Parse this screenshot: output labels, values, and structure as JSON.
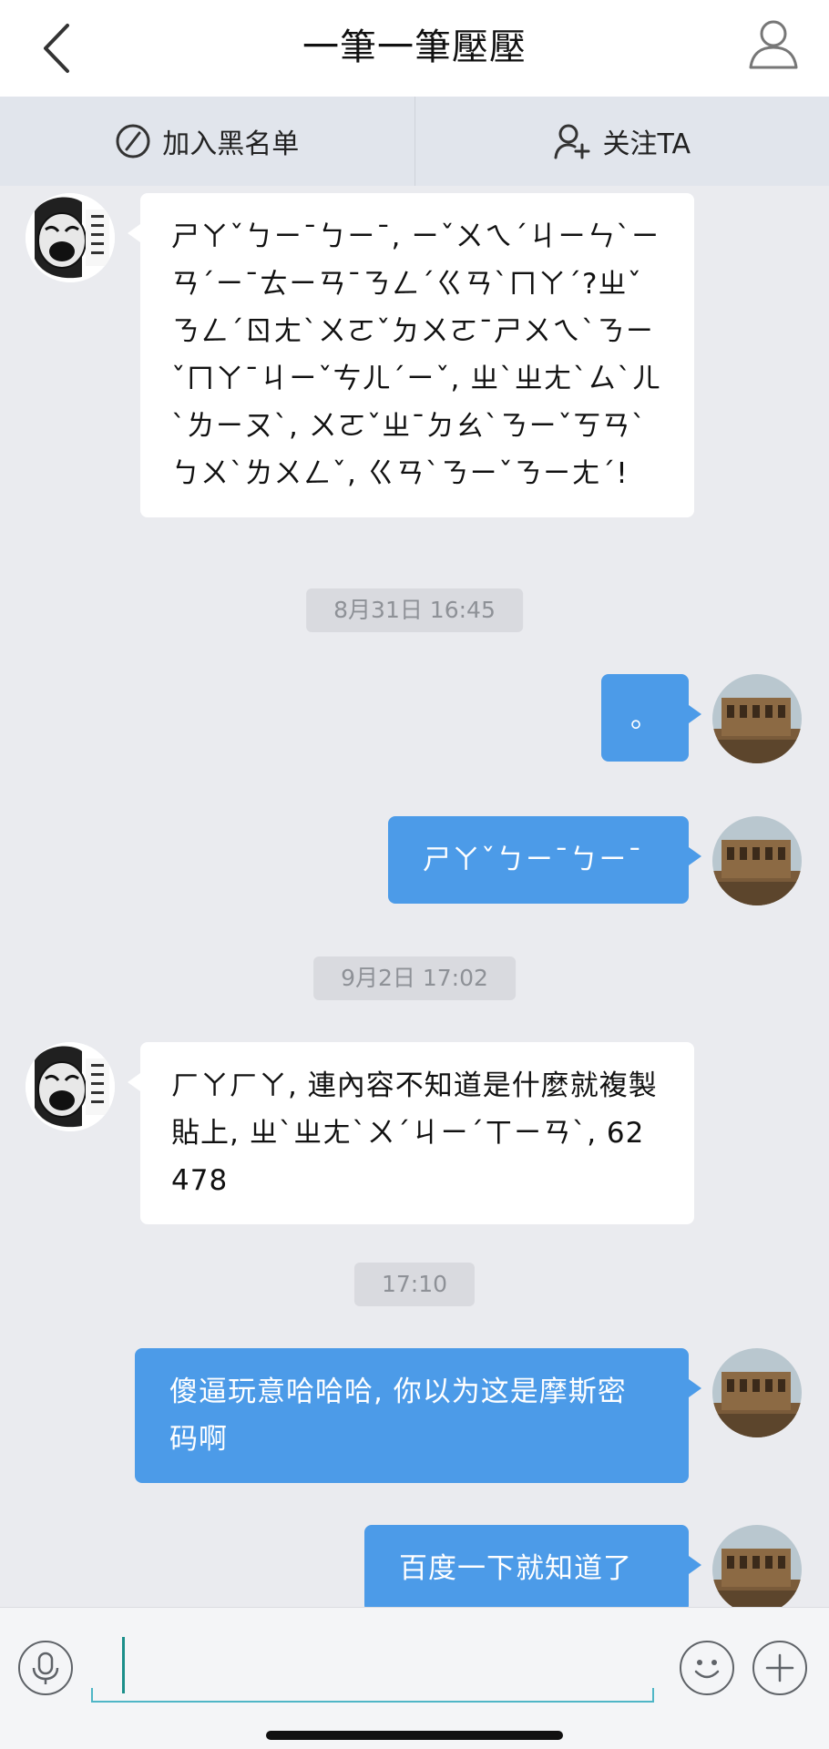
{
  "header": {
    "title": "一筆一筆壓壓"
  },
  "actions": {
    "block_label": "加入黑名单",
    "follow_label": "关注TA"
  },
  "messages": [
    {
      "kind": "in",
      "text": "ㄕㄚˇㄅㄧˉㄅㄧˉ, ㄧˇㄨㄟˊㄐㄧㄣˋㄧㄢˊㄧˉㄊㄧㄢˉㄋㄥˊㄍㄢˋㄇㄚˊ?ㄓˇㄋㄥˊㄖㄤˋㄨㄛˇㄉㄨㄛˉㄕㄨㄟˋㄋㄧˇㄇㄚˉㄐㄧˇㄘㄦˊㄧˇ, ㄓˋㄓㄤˋㄙˋㄦˋㄌㄧㄡˋ, ㄨㄛˇㄓˉㄉㄠˋㄋㄧˇㄎㄢˋㄅㄨˋㄌㄨㄥˇ, ㄍㄢˋㄋㄧˇㄋㄧㄤˊ!"
    },
    {
      "kind": "time",
      "text": "8月31日 16:45"
    },
    {
      "kind": "out",
      "text": "。"
    },
    {
      "kind": "out",
      "text": "ㄕㄚˇㄅㄧˉㄅㄧˉ"
    },
    {
      "kind": "time",
      "text": "9月2日 17:02"
    },
    {
      "kind": "in",
      "text": "ㄏㄚㄏㄚ, 連內容不知道是什麼就複製貼上, ㄓˋㄓㄤˋㄨˊㄐㄧˊㄒㄧㄢˋ, 62478"
    },
    {
      "kind": "time",
      "text": "17:10"
    },
    {
      "kind": "out",
      "text": "傻逼玩意哈哈哈, 你以为这是摩斯密码啊"
    },
    {
      "kind": "out",
      "text": "百度一下就知道了"
    }
  ],
  "input": {
    "value": "",
    "placeholder": ""
  },
  "colors": {
    "outgoing_bubble": "#4c9be8",
    "incoming_bubble": "#ffffff",
    "background": "#eaebef",
    "accent": "#4fb6c6"
  },
  "icons": {
    "back": "chevron-left-icon",
    "profile": "user-icon",
    "block": "prohibited-icon",
    "follow": "user-plus-icon",
    "voice": "microphone-icon",
    "emoji": "smiley-icon",
    "more": "plus-icon"
  }
}
